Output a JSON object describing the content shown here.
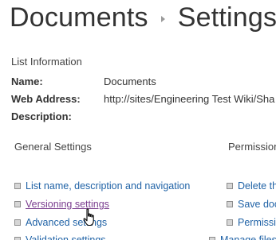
{
  "breadcrumb": {
    "parent": "Documents",
    "current": "Settings"
  },
  "list_information": {
    "heading": "List Information",
    "rows": [
      {
        "label": "Name:",
        "value": "Documents"
      },
      {
        "label": "Web Address:",
        "value": "http://sites/Engineering Test Wiki/Sha"
      },
      {
        "label": "Description:",
        "value": ""
      }
    ]
  },
  "general_settings": {
    "heading": "General Settings",
    "links": [
      {
        "label": "List name, description and navigation"
      },
      {
        "label": "Versioning settings"
      },
      {
        "label": "Advanced settings"
      },
      {
        "label": "Validation settings"
      }
    ]
  },
  "permissions": {
    "heading": "Permission",
    "links": [
      {
        "label": "Delete th"
      },
      {
        "label": "Save doc"
      },
      {
        "label": "Permissic"
      },
      {
        "label": "Manage files"
      }
    ]
  },
  "colors": {
    "link": "#1f62a6",
    "visited_link": "#7a3d8f",
    "title": "#333333",
    "bullet": "#d6d6d6"
  },
  "icons": {
    "breadcrumb_separator": "chevron-right-icon",
    "bullet": "square-bullet-icon",
    "cursor": "hand-pointer-cursor-icon"
  }
}
